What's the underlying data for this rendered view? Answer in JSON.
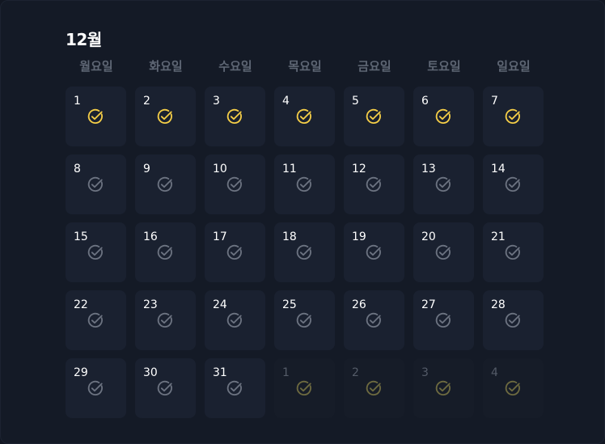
{
  "month_title": "12월",
  "weekdays": [
    "월요일",
    "화요일",
    "수요일",
    "목요일",
    "금요일",
    "토요일",
    "일요일"
  ],
  "colors": {
    "checked": "#f5ce47",
    "unchecked": "#6c7381",
    "other_checked": "#6d6a40"
  },
  "icon": "check-circle-icon",
  "weeks": [
    [
      {
        "day": "1",
        "checked": true,
        "other": false
      },
      {
        "day": "2",
        "checked": true,
        "other": false
      },
      {
        "day": "3",
        "checked": true,
        "other": false
      },
      {
        "day": "4",
        "checked": true,
        "other": false
      },
      {
        "day": "5",
        "checked": true,
        "other": false
      },
      {
        "day": "6",
        "checked": true,
        "other": false
      },
      {
        "day": "7",
        "checked": true,
        "other": false
      }
    ],
    [
      {
        "day": "8",
        "checked": false,
        "other": false
      },
      {
        "day": "9",
        "checked": false,
        "other": false
      },
      {
        "day": "10",
        "checked": false,
        "other": false
      },
      {
        "day": "11",
        "checked": false,
        "other": false
      },
      {
        "day": "12",
        "checked": false,
        "other": false
      },
      {
        "day": "13",
        "checked": false,
        "other": false
      },
      {
        "day": "14",
        "checked": false,
        "other": false
      }
    ],
    [
      {
        "day": "15",
        "checked": false,
        "other": false
      },
      {
        "day": "16",
        "checked": false,
        "other": false
      },
      {
        "day": "17",
        "checked": false,
        "other": false
      },
      {
        "day": "18",
        "checked": false,
        "other": false
      },
      {
        "day": "19",
        "checked": false,
        "other": false
      },
      {
        "day": "20",
        "checked": false,
        "other": false
      },
      {
        "day": "21",
        "checked": false,
        "other": false
      }
    ],
    [
      {
        "day": "22",
        "checked": false,
        "other": false
      },
      {
        "day": "23",
        "checked": false,
        "other": false
      },
      {
        "day": "24",
        "checked": false,
        "other": false
      },
      {
        "day": "25",
        "checked": false,
        "other": false
      },
      {
        "day": "26",
        "checked": false,
        "other": false
      },
      {
        "day": "27",
        "checked": false,
        "other": false
      },
      {
        "day": "28",
        "checked": false,
        "other": false
      }
    ],
    [
      {
        "day": "29",
        "checked": false,
        "other": false
      },
      {
        "day": "30",
        "checked": false,
        "other": false
      },
      {
        "day": "31",
        "checked": false,
        "other": false
      },
      {
        "day": "1",
        "checked": true,
        "other": true
      },
      {
        "day": "2",
        "checked": true,
        "other": true
      },
      {
        "day": "3",
        "checked": true,
        "other": true
      },
      {
        "day": "4",
        "checked": true,
        "other": true
      }
    ]
  ]
}
